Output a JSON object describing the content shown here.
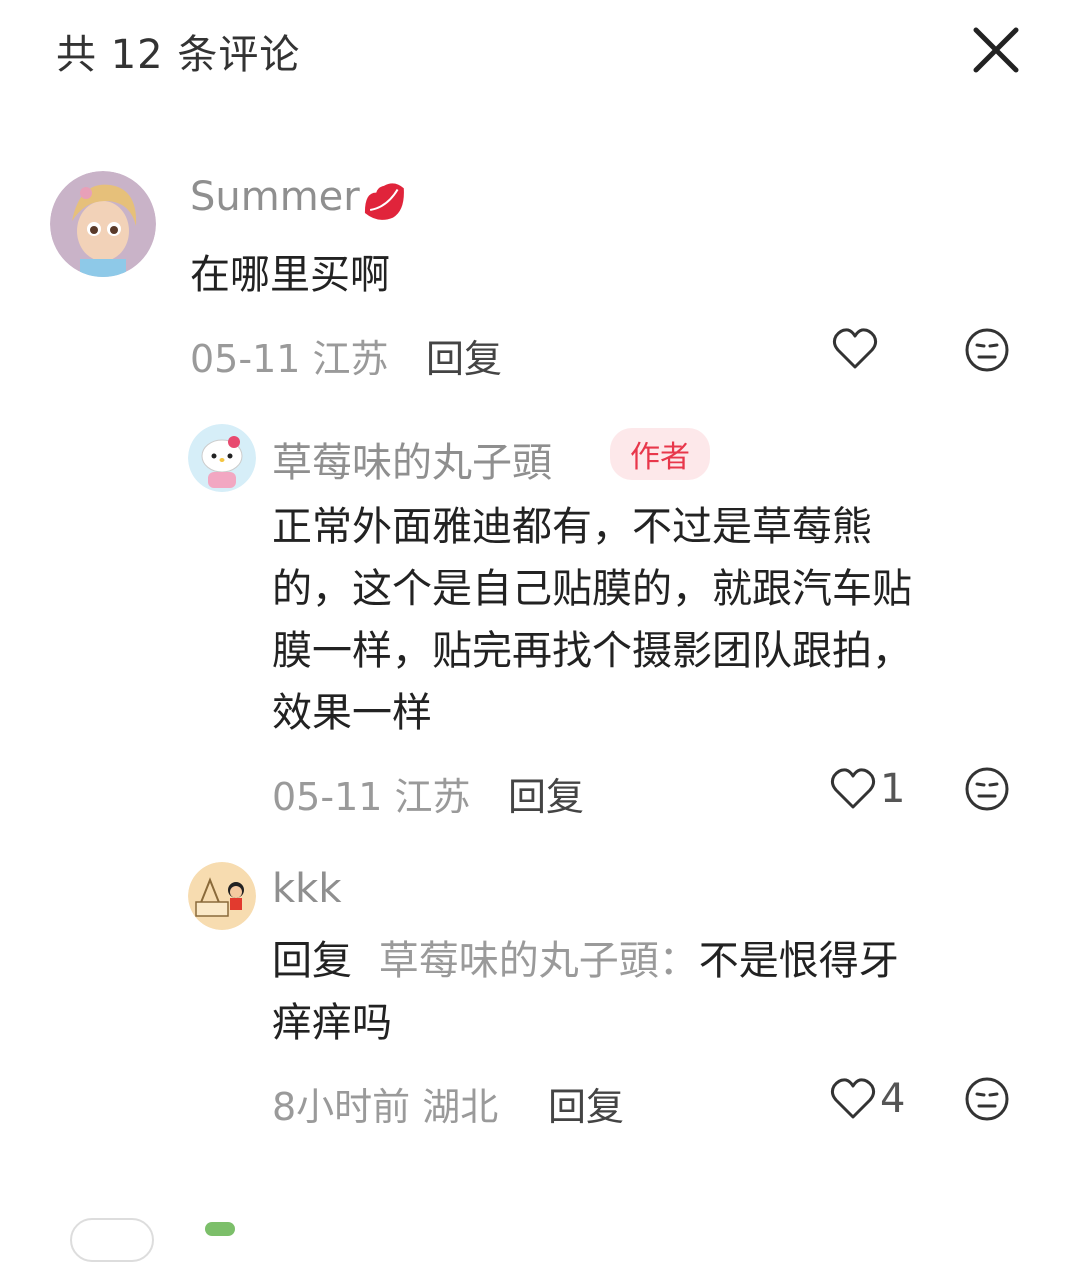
{
  "header": {
    "title": "共 12 条评论"
  },
  "comments": [
    {
      "user": "Summer",
      "text": "在哪里买啊",
      "date": "05-11",
      "location": "江苏",
      "reply_label": "回复",
      "likes": ""
    },
    {
      "user": "草莓味的丸子頭",
      "badge": "作者",
      "lines": [
        "正常外面雅迪都有，不过是草莓熊",
        "的，这个是自己贴膜的，就跟汽车贴",
        "膜一样，贴完再找个摄影团队跟拍，",
        "效果一样"
      ],
      "date": "05-11",
      "location": "江苏",
      "reply_label": "回复",
      "likes": "1"
    },
    {
      "user": "kkk",
      "reply_prefix": "回复",
      "reply_target": "草莓味的丸子頭：",
      "line1_rest": "不是恨得牙",
      "line2": "痒痒吗",
      "date": "8小时前",
      "location": "湖北",
      "reply_label": "回复",
      "likes": "4"
    }
  ],
  "icons": {
    "close": "close-icon",
    "heart": "heart-outline-icon",
    "dislike": "neutral-face-icon",
    "lips": "lips-emoji-icon"
  },
  "colors": {
    "author_badge_bg": "#fde8ea",
    "author_badge_text": "#e8374b",
    "lips": "#e0243b"
  }
}
